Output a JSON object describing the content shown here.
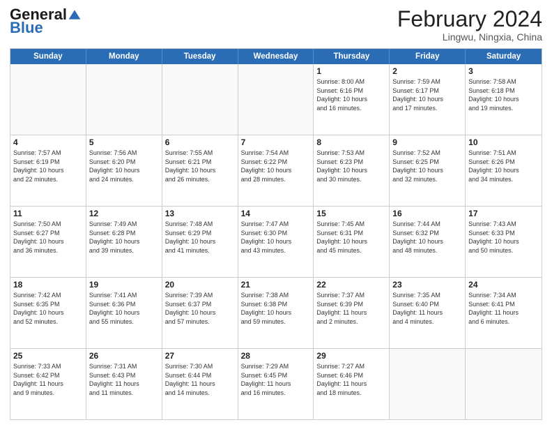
{
  "header": {
    "logo_line1": "General",
    "logo_line2": "Blue",
    "title": "February 2024",
    "subtitle": "Lingwu, Ningxia, China"
  },
  "weekdays": [
    "Sunday",
    "Monday",
    "Tuesday",
    "Wednesday",
    "Thursday",
    "Friday",
    "Saturday"
  ],
  "rows": [
    [
      {
        "day": "",
        "info": ""
      },
      {
        "day": "",
        "info": ""
      },
      {
        "day": "",
        "info": ""
      },
      {
        "day": "",
        "info": ""
      },
      {
        "day": "1",
        "info": "Sunrise: 8:00 AM\nSunset: 6:16 PM\nDaylight: 10 hours\nand 16 minutes."
      },
      {
        "day": "2",
        "info": "Sunrise: 7:59 AM\nSunset: 6:17 PM\nDaylight: 10 hours\nand 17 minutes."
      },
      {
        "day": "3",
        "info": "Sunrise: 7:58 AM\nSunset: 6:18 PM\nDaylight: 10 hours\nand 19 minutes."
      }
    ],
    [
      {
        "day": "4",
        "info": "Sunrise: 7:57 AM\nSunset: 6:19 PM\nDaylight: 10 hours\nand 22 minutes."
      },
      {
        "day": "5",
        "info": "Sunrise: 7:56 AM\nSunset: 6:20 PM\nDaylight: 10 hours\nand 24 minutes."
      },
      {
        "day": "6",
        "info": "Sunrise: 7:55 AM\nSunset: 6:21 PM\nDaylight: 10 hours\nand 26 minutes."
      },
      {
        "day": "7",
        "info": "Sunrise: 7:54 AM\nSunset: 6:22 PM\nDaylight: 10 hours\nand 28 minutes."
      },
      {
        "day": "8",
        "info": "Sunrise: 7:53 AM\nSunset: 6:23 PM\nDaylight: 10 hours\nand 30 minutes."
      },
      {
        "day": "9",
        "info": "Sunrise: 7:52 AM\nSunset: 6:25 PM\nDaylight: 10 hours\nand 32 minutes."
      },
      {
        "day": "10",
        "info": "Sunrise: 7:51 AM\nSunset: 6:26 PM\nDaylight: 10 hours\nand 34 minutes."
      }
    ],
    [
      {
        "day": "11",
        "info": "Sunrise: 7:50 AM\nSunset: 6:27 PM\nDaylight: 10 hours\nand 36 minutes."
      },
      {
        "day": "12",
        "info": "Sunrise: 7:49 AM\nSunset: 6:28 PM\nDaylight: 10 hours\nand 39 minutes."
      },
      {
        "day": "13",
        "info": "Sunrise: 7:48 AM\nSunset: 6:29 PM\nDaylight: 10 hours\nand 41 minutes."
      },
      {
        "day": "14",
        "info": "Sunrise: 7:47 AM\nSunset: 6:30 PM\nDaylight: 10 hours\nand 43 minutes."
      },
      {
        "day": "15",
        "info": "Sunrise: 7:45 AM\nSunset: 6:31 PM\nDaylight: 10 hours\nand 45 minutes."
      },
      {
        "day": "16",
        "info": "Sunrise: 7:44 AM\nSunset: 6:32 PM\nDaylight: 10 hours\nand 48 minutes."
      },
      {
        "day": "17",
        "info": "Sunrise: 7:43 AM\nSunset: 6:33 PM\nDaylight: 10 hours\nand 50 minutes."
      }
    ],
    [
      {
        "day": "18",
        "info": "Sunrise: 7:42 AM\nSunset: 6:35 PM\nDaylight: 10 hours\nand 52 minutes."
      },
      {
        "day": "19",
        "info": "Sunrise: 7:41 AM\nSunset: 6:36 PM\nDaylight: 10 hours\nand 55 minutes."
      },
      {
        "day": "20",
        "info": "Sunrise: 7:39 AM\nSunset: 6:37 PM\nDaylight: 10 hours\nand 57 minutes."
      },
      {
        "day": "21",
        "info": "Sunrise: 7:38 AM\nSunset: 6:38 PM\nDaylight: 10 hours\nand 59 minutes."
      },
      {
        "day": "22",
        "info": "Sunrise: 7:37 AM\nSunset: 6:39 PM\nDaylight: 11 hours\nand 2 minutes."
      },
      {
        "day": "23",
        "info": "Sunrise: 7:35 AM\nSunset: 6:40 PM\nDaylight: 11 hours\nand 4 minutes."
      },
      {
        "day": "24",
        "info": "Sunrise: 7:34 AM\nSunset: 6:41 PM\nDaylight: 11 hours\nand 6 minutes."
      }
    ],
    [
      {
        "day": "25",
        "info": "Sunrise: 7:33 AM\nSunset: 6:42 PM\nDaylight: 11 hours\nand 9 minutes."
      },
      {
        "day": "26",
        "info": "Sunrise: 7:31 AM\nSunset: 6:43 PM\nDaylight: 11 hours\nand 11 minutes."
      },
      {
        "day": "27",
        "info": "Sunrise: 7:30 AM\nSunset: 6:44 PM\nDaylight: 11 hours\nand 14 minutes."
      },
      {
        "day": "28",
        "info": "Sunrise: 7:29 AM\nSunset: 6:45 PM\nDaylight: 11 hours\nand 16 minutes."
      },
      {
        "day": "29",
        "info": "Sunrise: 7:27 AM\nSunset: 6:46 PM\nDaylight: 11 hours\nand 18 minutes."
      },
      {
        "day": "",
        "info": ""
      },
      {
        "day": "",
        "info": ""
      }
    ]
  ]
}
